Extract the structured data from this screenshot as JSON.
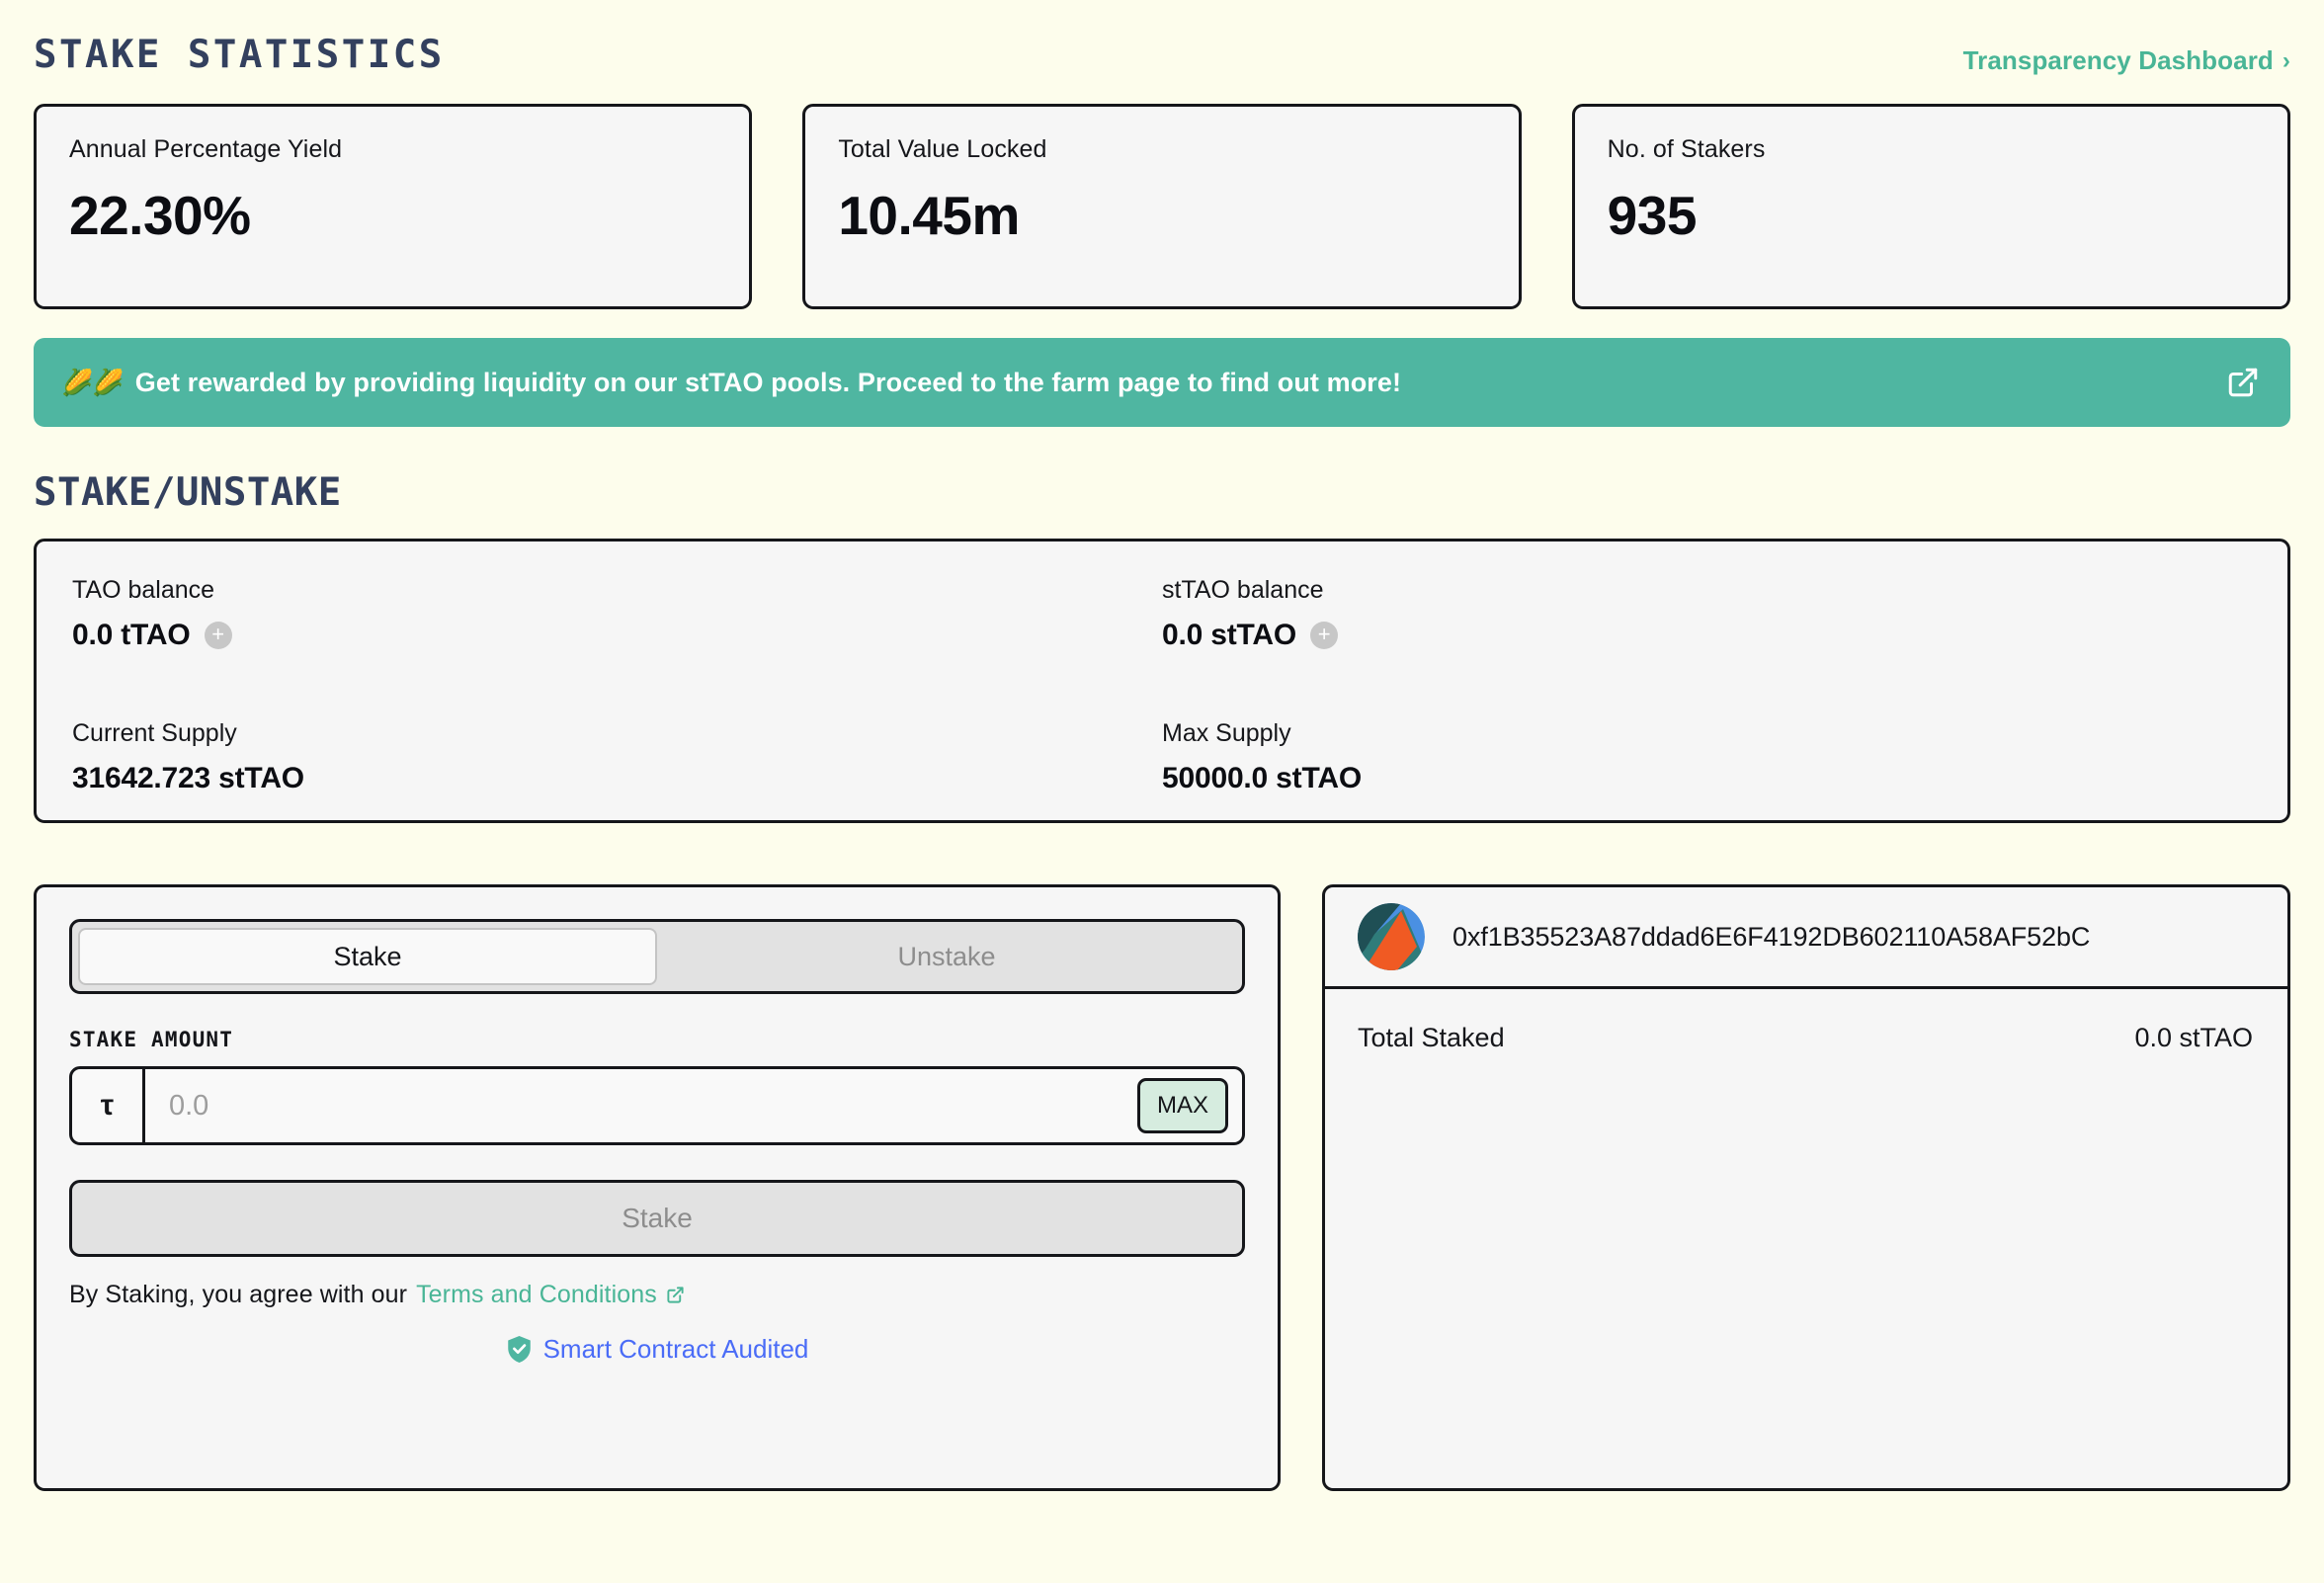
{
  "stats_section": {
    "title": "STAKE STATISTICS",
    "dashboard_link": "Transparency Dashboard",
    "dashboard_chevron": "›",
    "cards": [
      {
        "label": "Annual Percentage Yield",
        "value": "22.30%"
      },
      {
        "label": "Total Value Locked",
        "value": "10.45m"
      },
      {
        "label": "No. of Stakers",
        "value": "935"
      }
    ]
  },
  "banner": {
    "emoji": "🌽🌽",
    "text": "Get rewarded by providing liquidity on our stTAO pools. Proceed to the farm page to find out more!",
    "icon": "external-link-icon",
    "background": "#4fb6a1"
  },
  "stake_section": {
    "title": "STAKE/UNSTAKE",
    "balances": {
      "tao_label": "TAO balance",
      "tao_value": "0.0 tTAO",
      "sttao_label": "stTAO balance",
      "sttao_value": "0.0 stTAO",
      "current_supply_label": "Current Supply",
      "current_supply_value": "31642.723 stTAO",
      "max_supply_label": "Max Supply",
      "max_supply_value": "50000.0 stTAO",
      "add_token_icon": "+"
    },
    "tabs": [
      {
        "label": "Stake",
        "active": true
      },
      {
        "label": "Unstake",
        "active": false
      }
    ],
    "amount_label": "STAKE AMOUNT",
    "currency_symbol": "τ",
    "amount_value": "",
    "amount_placeholder": "0.0",
    "max_button": "MAX",
    "submit_button": "Stake",
    "terms_prefix": "By Staking, you agree with our",
    "terms_link": "Terms and Conditions",
    "audited_label": "Smart Contract Audited"
  },
  "account": {
    "address": "0xf1B35523A87ddad6E6F4192DB602110A58AF52bC",
    "avatar": "wallet-blockie-avatar",
    "total_staked_label": "Total Staked",
    "total_staked_value": "0.0 stTAO"
  },
  "colors": {
    "page_background": "#fdfdec",
    "accent_teal": "#49b596",
    "banner_teal": "#4fb6a1",
    "heading_navy": "#33405e",
    "border_dark": "#15161a",
    "card_gray": "#f6f6f6",
    "audit_blue": "#4a6cf7",
    "max_green": "#d6ecdf"
  }
}
